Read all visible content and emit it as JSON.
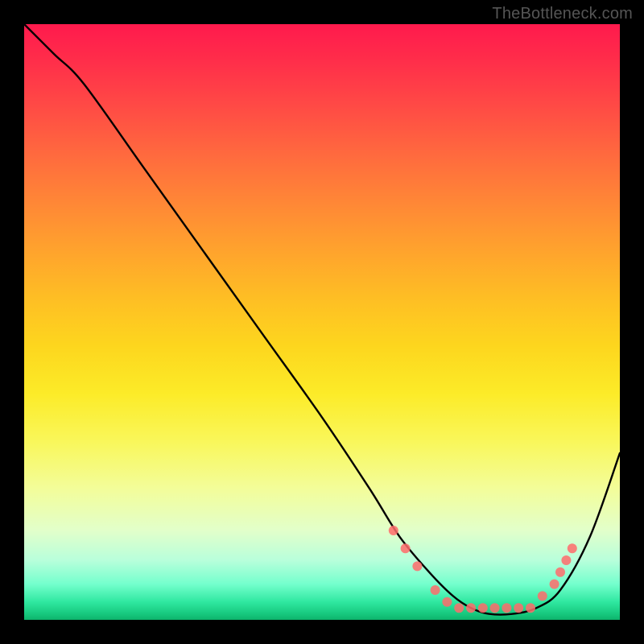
{
  "watermark": "TheBottleneck.com",
  "chart_data": {
    "type": "line",
    "title": "",
    "xlabel": "",
    "ylabel": "",
    "xlim": [
      0,
      100
    ],
    "ylim": [
      0,
      100
    ],
    "grid": false,
    "legend": false,
    "series": [
      {
        "name": "bottleneck-curve",
        "x": [
          0,
          5,
          10,
          20,
          30,
          40,
          50,
          58,
          63,
          68,
          72,
          75,
          78,
          82,
          86,
          90,
          95,
          100
        ],
        "values": [
          100,
          95,
          90,
          76,
          62,
          48,
          34,
          22,
          14,
          8,
          4,
          2,
          1,
          1,
          2,
          5,
          14,
          28
        ]
      }
    ],
    "markers": {
      "name": "highlight-points",
      "color": "#ff6b6b",
      "radius": 6,
      "points": [
        {
          "x": 62,
          "y": 15
        },
        {
          "x": 64,
          "y": 12
        },
        {
          "x": 66,
          "y": 9
        },
        {
          "x": 69,
          "y": 5
        },
        {
          "x": 71,
          "y": 3
        },
        {
          "x": 73,
          "y": 2
        },
        {
          "x": 75,
          "y": 2
        },
        {
          "x": 77,
          "y": 2
        },
        {
          "x": 79,
          "y": 2
        },
        {
          "x": 81,
          "y": 2
        },
        {
          "x": 83,
          "y": 2
        },
        {
          "x": 85,
          "y": 2
        },
        {
          "x": 87,
          "y": 4
        },
        {
          "x": 89,
          "y": 6
        },
        {
          "x": 90,
          "y": 8
        },
        {
          "x": 91,
          "y": 10
        },
        {
          "x": 92,
          "y": 12
        }
      ]
    },
    "gradient_stops": [
      {
        "pos": 0,
        "color": "#ff1a4d"
      },
      {
        "pos": 50,
        "color": "#fdd61e"
      },
      {
        "pos": 85,
        "color": "#e2ffca"
      },
      {
        "pos": 100,
        "color": "#0eb36b"
      }
    ]
  }
}
